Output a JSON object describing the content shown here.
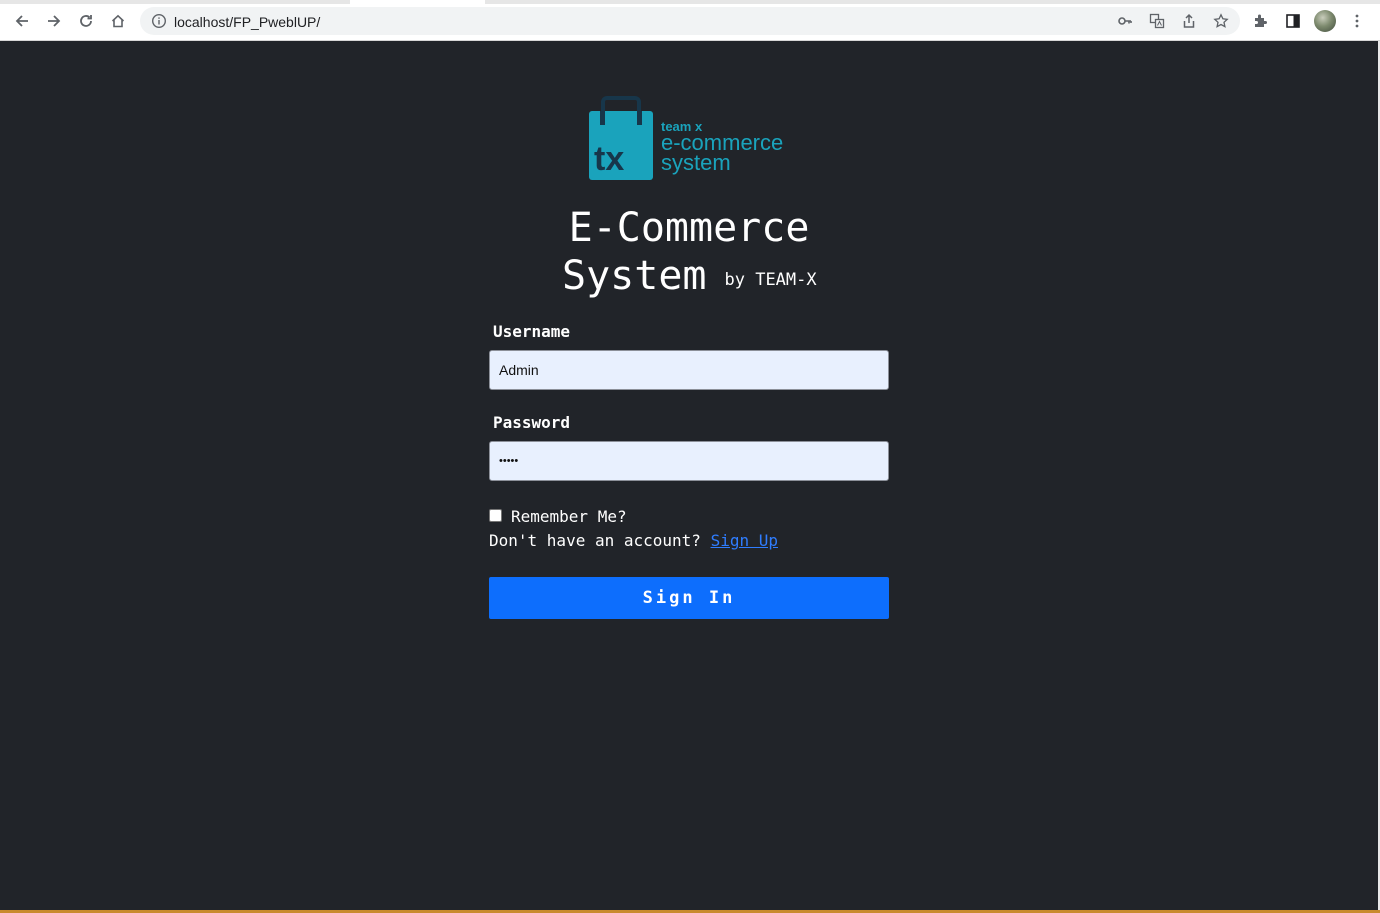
{
  "browser": {
    "url": "localhost/FP_PweblUP/"
  },
  "logo": {
    "monogram": "tx",
    "line1": "team x",
    "line2": "e-commerce",
    "line3": "system",
    "color": "#1aa3bc"
  },
  "page": {
    "title_line1": "E-Commerce",
    "title_line2": "System",
    "byline": "by TEAM-X",
    "background": "#212429"
  },
  "form": {
    "username_label": "Username",
    "username_value": "Admin",
    "password_label": "Password",
    "password_value": "•••••",
    "remember_label": "Remember Me?",
    "remember_checked": false,
    "signup_prompt": "Don't have an account?",
    "signup_link": "Sign Up",
    "submit_label": "Sign In",
    "submit_color": "#0d6efd"
  }
}
